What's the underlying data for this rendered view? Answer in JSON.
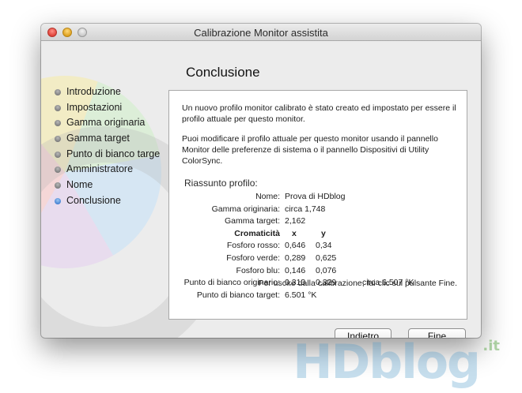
{
  "window": {
    "title": "Calibrazione Monitor assistita",
    "heading": "Conclusione"
  },
  "steps": [
    {
      "label": "Introduzione"
    },
    {
      "label": "Impostazioni"
    },
    {
      "label": "Gamma originaria"
    },
    {
      "label": "Gamma target"
    },
    {
      "label": "Punto di bianco targe"
    },
    {
      "label": "Amministratore"
    },
    {
      "label": "Nome"
    },
    {
      "label": "Conclusione",
      "active": true
    }
  ],
  "panel": {
    "paragraph1": "Un nuovo profilo monitor calibrato è stato creato ed impostato per essere il profilo attuale per questo monitor.",
    "paragraph2": "Puoi modificare il profilo attuale per questo monitor usando il pannello Monitor delle preferenze di sistema o il pannello Dispositivi di Utility ColorSync.",
    "summary_heading": "Riassunto profilo:",
    "summary": {
      "name": {
        "label": "Nome:",
        "value": "Prova di HDblog"
      },
      "gamma_original": {
        "label": "Gamma originaria:",
        "value": "circa 1,748"
      },
      "gamma_target": {
        "label": "Gamma target:",
        "value": "2,162"
      },
      "chromaticity": {
        "label": "Cromaticità",
        "x": "x",
        "y": "y"
      },
      "phosphor_red": {
        "label": "Fosforo rosso:",
        "x": "0,646",
        "y": "0,34"
      },
      "phosphor_green": {
        "label": "Fosforo verde:",
        "x": "0,289",
        "y": "0,625"
      },
      "phosphor_blue": {
        "label": "Fosforo blu:",
        "x": "0,146",
        "y": "0,076"
      },
      "white_original": {
        "label": "Punto di bianco originario:",
        "x": "0,313",
        "y": "0,329",
        "note": "circa 6.507 °K"
      },
      "white_target": {
        "label": "Punto di bianco target:",
        "value": "6.501 °K"
      }
    },
    "footer_note": "Per uscire dalla calibrazione, fai clic sul pulsante Fine."
  },
  "buttons": {
    "back": "Indietro",
    "done": "Fine"
  },
  "watermark": {
    "text": "HDblog",
    "suffix": ".it"
  }
}
